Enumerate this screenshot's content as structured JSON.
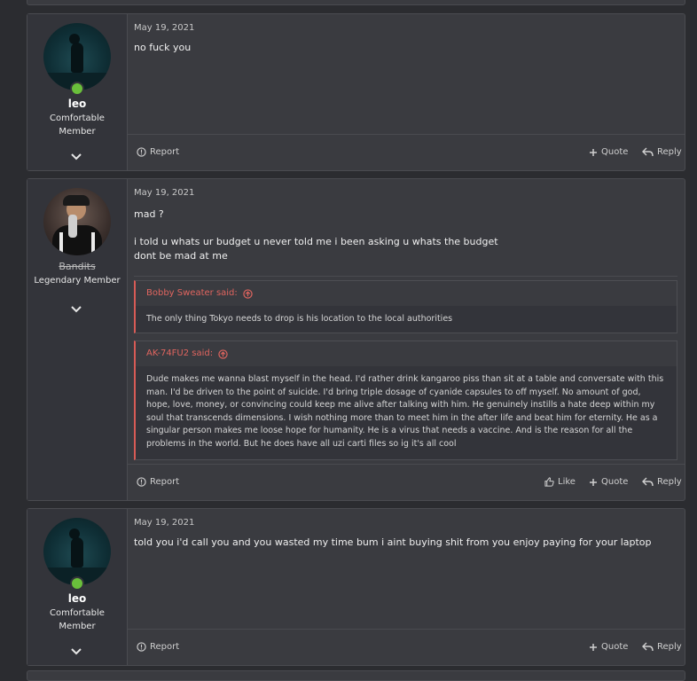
{
  "posts": [
    {
      "user": {
        "name": "leo",
        "title_line1": "Comfortable",
        "title_line2": "Member",
        "online": true
      },
      "date": "May 19, 2021",
      "message": "no fuck you",
      "actions": {
        "report": "Report",
        "quote": "Quote",
        "reply": "Reply"
      }
    },
    {
      "user": {
        "name": "Bandits",
        "title_line1": "Legendary Member",
        "online": false
      },
      "date": "May 19, 2021",
      "message_lines": [
        "mad ?",
        "i told u whats ur budget u never told me i been asking u whats the budget",
        "dont be mad at me"
      ],
      "quotes": [
        {
          "author": "Bobby Sweater said:",
          "text": "The only thing Tokyo needs to drop is his location to the local authorities"
        },
        {
          "author": "AK-74FU2 said:",
          "text": "Dude makes me wanna blast myself in the head. I'd rather drink kangaroo piss than sit at a table and conversate with this man. I'd be driven to the point of suicide. I'd bring triple dosage of cyanide capsules to off myself. No amount of god, hope, love, money, or convincing could keep me alive after talking with him. He genuinely instills a hate deep within my soul that transcends dimensions. I wish nothing more than to meet him in the after life and beat him for eternity. He as a singular person makes me loose hope for humanity. He is a virus that needs a vaccine. And is the reason for all the problems in the world. But he does have all uzi carti files so ig it's all cool"
        }
      ],
      "actions": {
        "report": "Report",
        "like": "Like",
        "quote": "Quote",
        "reply": "Reply"
      }
    },
    {
      "user": {
        "name": "leo",
        "title_line1": "Comfortable",
        "title_line2": "Member",
        "online": true
      },
      "date": "May 19, 2021",
      "message": "told you i'd call you and you wasted my time bum i aint buying shit from you enjoy paying for your laptop",
      "actions": {
        "report": "Report",
        "quote": "Quote",
        "reply": "Reply"
      }
    }
  ],
  "colors": {
    "background": "#2b2c30",
    "post": "#3a3b40",
    "quote_accent": "#d85b56",
    "online": "#6abf3b"
  },
  "icons": [
    "chevron-down-icon",
    "report-icon",
    "plus-icon",
    "reply-icon",
    "like-icon",
    "arrow-up-circle-icon"
  ]
}
